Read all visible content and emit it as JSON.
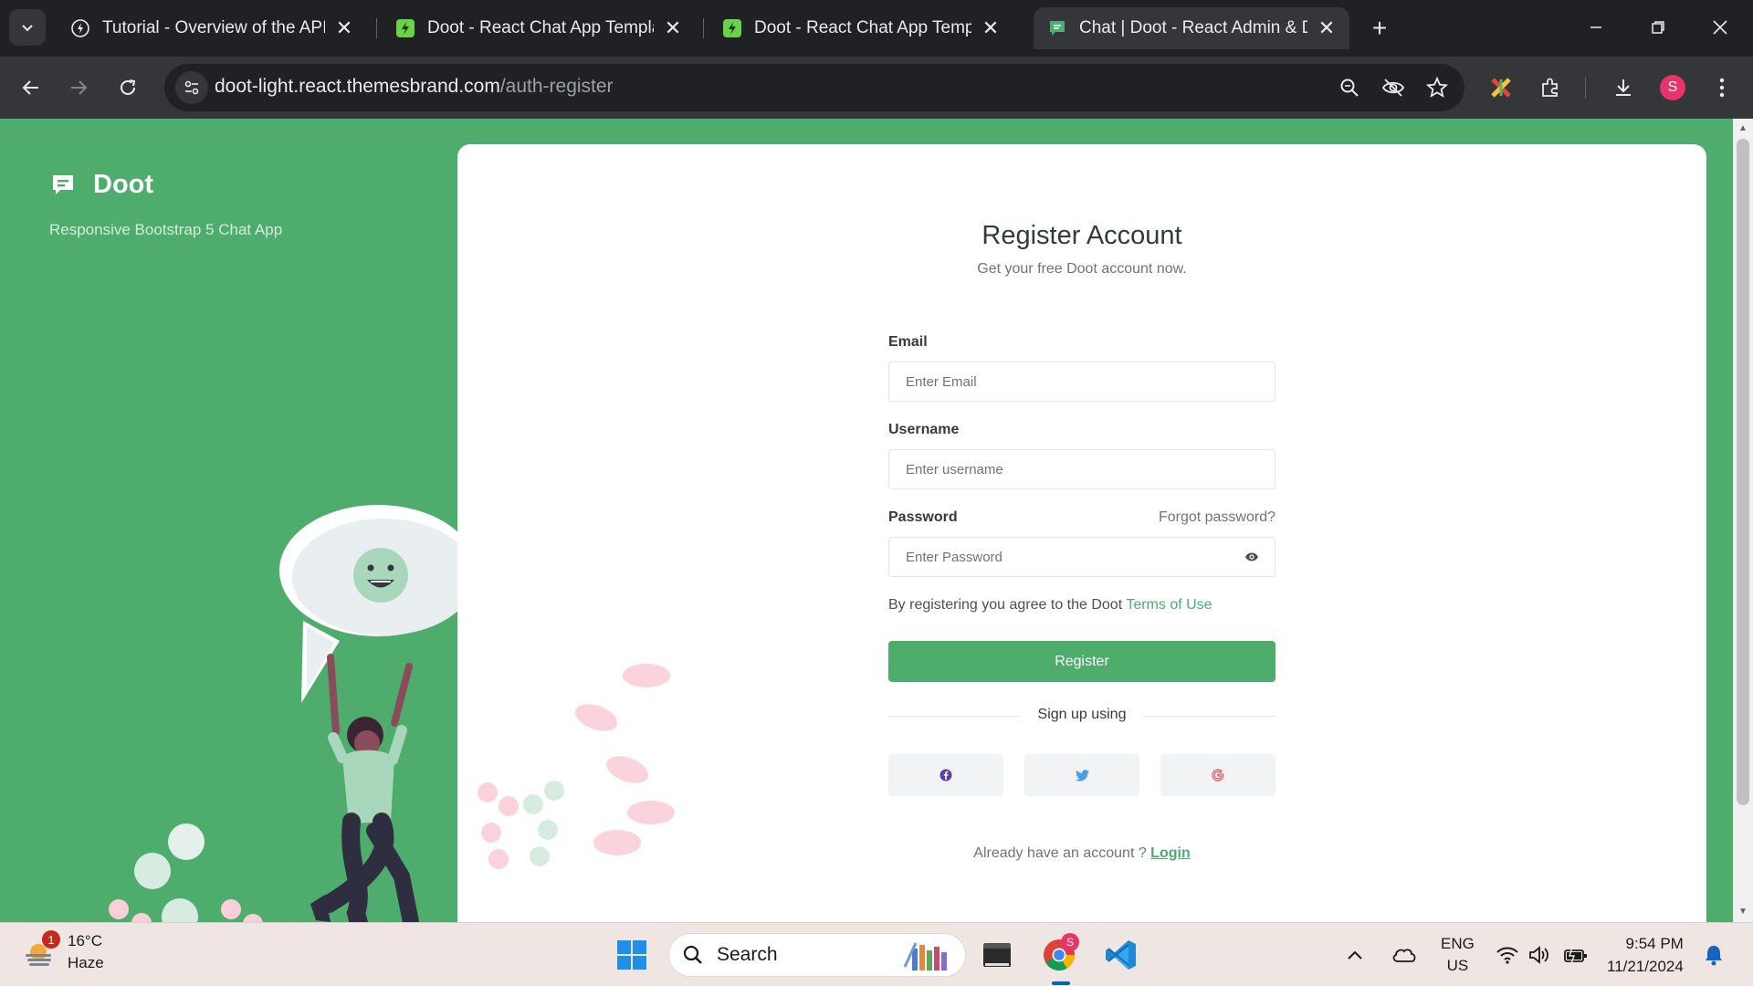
{
  "browser": {
    "tabs": [
      {
        "title": "Tutorial - Overview of the API |",
        "active": false
      },
      {
        "title": "Doot - React Chat App Templat",
        "active": false
      },
      {
        "title": "Doot - React Chat App Templat",
        "active": false
      },
      {
        "title": "Chat | Doot - React Admin & Da",
        "active": true
      }
    ],
    "url_host": "doot-light.react.themesbrand.com",
    "url_path": "/auth-register",
    "profile_initial": "S"
  },
  "sidebar": {
    "brand": "Doot",
    "tagline": "Responsive Bootstrap 5 Chat App"
  },
  "form": {
    "title": "Register Account",
    "subtitle": "Get your free Doot account now.",
    "email_label": "Email",
    "email_placeholder": "Enter Email",
    "username_label": "Username",
    "username_placeholder": "Enter username",
    "password_label": "Password",
    "forgot_password": "Forgot password?",
    "password_placeholder": "Enter Password",
    "terms_prefix": "By registering you agree to the Doot ",
    "terms_link": "Terms of Use",
    "register_button": "Register",
    "signup_using": "Sign up using",
    "social": [
      "facebook-icon",
      "twitter-icon",
      "google-icon"
    ],
    "already_prefix": "Already have an account ? ",
    "login_link": "Login"
  },
  "colors": {
    "accent": "#4eac6d",
    "facebook": "#5b3fa7",
    "twitter": "#4a9ee8",
    "google": "#e5566a"
  },
  "taskbar": {
    "weather_badge": "1",
    "temperature": "16°C",
    "condition": "Haze",
    "search_label": "Search",
    "lang_top": "ENG",
    "lang_bottom": "US",
    "time": "9:54 PM",
    "date": "11/21/2024",
    "chrome_badge": "S"
  }
}
